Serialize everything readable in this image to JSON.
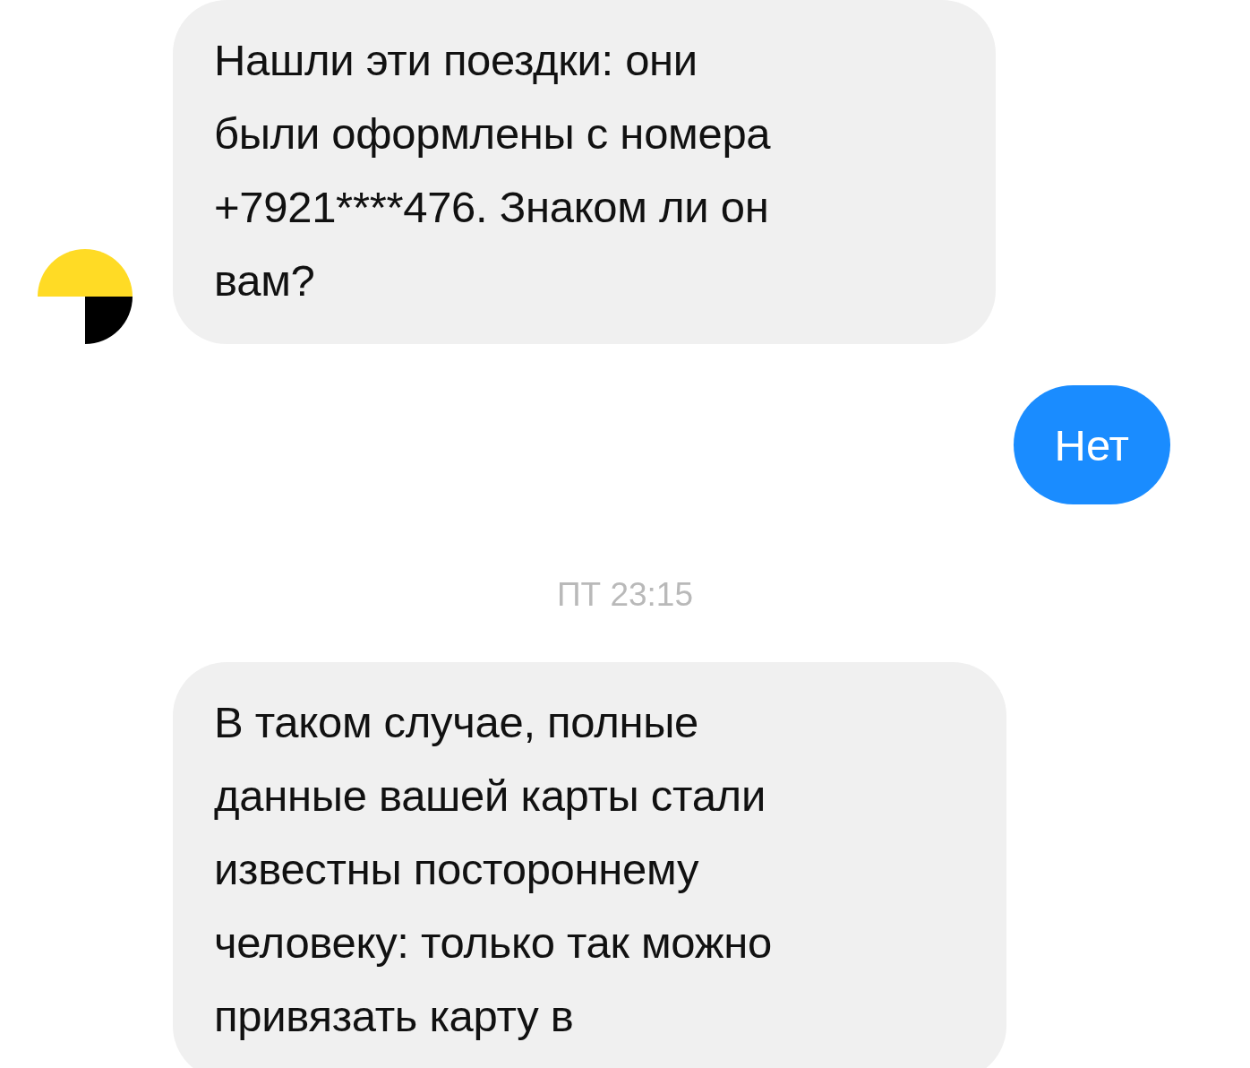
{
  "messages": [
    {
      "kind": "incoming",
      "avatar": true,
      "text": "Нашли эти поездки: они\nбыли оформлены с номера\n+7921****476. Знаком ли он\nвам?"
    },
    {
      "kind": "outgoing",
      "text": "Нет"
    },
    {
      "kind": "timestamp",
      "text": "ПТ 23:15"
    },
    {
      "kind": "incoming",
      "avatar": false,
      "text": "В таком случае, полные\nданные вашей карты стали\nизвестны постороннему\nчеловеку: только так можно\nпривязать карту в"
    }
  ]
}
